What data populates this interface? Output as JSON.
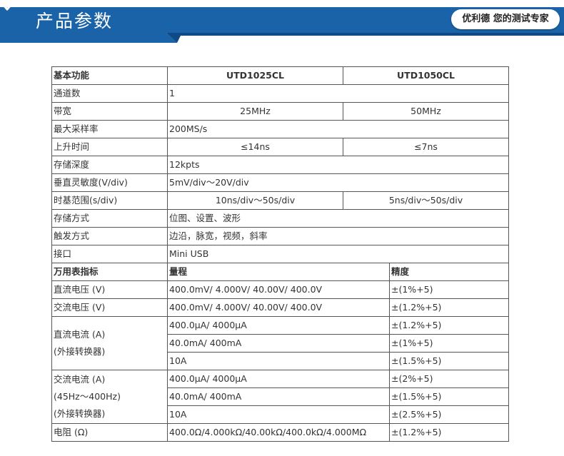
{
  "banner": {
    "title": "产品参数",
    "chevron_icon": "chevron-down-icon",
    "slogan": "优利德 您的测试专家",
    "colors": {
      "blue": "#1a63a8",
      "dark_blue": "#0f4a86",
      "white": "#ffffff"
    }
  },
  "spec": {
    "header": {
      "label": "基本功能",
      "model1": "UTD1025CL",
      "model2": "UTD1050CL"
    },
    "channels": {
      "label": "通道数",
      "value": "1"
    },
    "bandwidth": {
      "label": "带宽",
      "v1": "25MHz",
      "v2": "50MHz"
    },
    "sample_rate": {
      "label": "最大采样率",
      "value": "200MS/s"
    },
    "rise_time": {
      "label": "上升时间",
      "v1": "≤14ns",
      "v2": "≤7ns"
    },
    "memory": {
      "label": "存储深度",
      "value": "12kpts"
    },
    "vertical": {
      "label": "垂直灵敏度(V/div)",
      "value": "5mV/div～20V/div"
    },
    "timebase": {
      "label": "时基范围(s/div)",
      "v1": "10ns/div～50s/div",
      "v2": "5ns/div～50s/div"
    },
    "storage": {
      "label": "存储方式",
      "value": "位图、设置、波形"
    },
    "trigger": {
      "label": "触发方式",
      "value": "边沿，脉宽，视频，斜率"
    },
    "interface": {
      "label": "接口",
      "value": "Mini USB"
    }
  },
  "meter": {
    "header": {
      "label": "万用表指标",
      "range": "量程",
      "accuracy": "精度"
    },
    "dcv": {
      "label": "直流电压 (V)",
      "range": "400.0mV/ 4.000V/ 40.00V/ 400.0V",
      "acc": "±(1%+5)"
    },
    "acv": {
      "label": "交流电压 (V)",
      "range": "400.0mV/ 4.000V/ 40.00V/ 400.0V",
      "acc": "±(1.2%+5)"
    },
    "dca": {
      "label1": "直流电流 (A)",
      "label2": "(外接转换器)",
      "rows": [
        {
          "range": "400.0μA/ 4000μA",
          "acc": "±(1.2%+5)"
        },
        {
          "range": "40.0mA/ 400mA",
          "acc": "±(1%+5)"
        },
        {
          "range": "10A",
          "acc": "±(1.5%+5)"
        }
      ]
    },
    "aca": {
      "label1": "交流电流 (A)",
      "label2": "(45Hz～400Hz)",
      "label3": "(外接转换器)",
      "rows": [
        {
          "range": "400.0μA/ 4000μA",
          "acc": "±(2%+5)"
        },
        {
          "range": "40.0mA/ 400mA",
          "acc": "±(1.5%+5)"
        },
        {
          "range": "10A",
          "acc": "±(2.5%+5)"
        }
      ]
    },
    "resistance": {
      "label": "电阻 (Ω)",
      "range": "400.0Ω/4.000kΩ/40.00kΩ/400.0kΩ/4.000MΩ",
      "acc": "±(1.2%+5)"
    }
  }
}
